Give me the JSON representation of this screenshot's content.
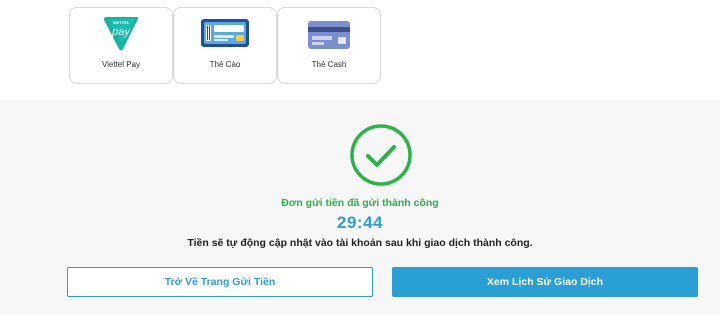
{
  "payment_methods": [
    {
      "label": "Viettel Pay",
      "logo_text": "pay",
      "logo_subtext": "VIETTEL",
      "icon": "viettel-pay-logo"
    },
    {
      "label": "Thẻ Cào",
      "icon": "scratch-card-icon"
    },
    {
      "label": "Thẻ Cash",
      "icon": "cash-card-icon"
    }
  ],
  "success": {
    "icon": "check-circle-icon",
    "title": "Đơn gửi tiền đã gửi thành công",
    "timer": "29:44",
    "message": "Tiền sẽ tự động cập nhật vào tài khoản sau khi giao dịch thành công."
  },
  "buttons": {
    "back_label": "Trở Về Trang Gửi Tiền",
    "history_label": "Xem Lịch Sử Giao Dịch"
  },
  "colors": {
    "success_green": "#28b446",
    "accent_blue": "#2a9fd6",
    "viettel_teal": "#17b3a3",
    "panel_bg": "#f7f7f7"
  }
}
